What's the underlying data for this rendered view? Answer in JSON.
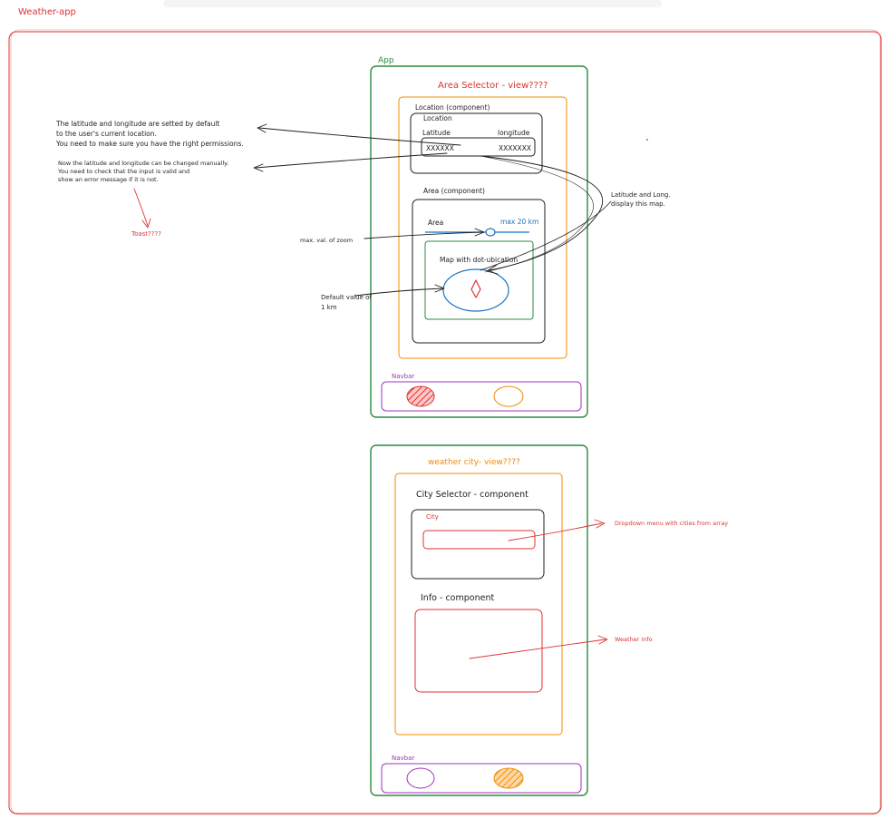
{
  "board": {
    "title": "Weather-app"
  },
  "app_label": "App",
  "colors": {
    "red": "#e03131",
    "green": "#2b8a3e",
    "orange": "#f08c00",
    "purple": "#9c36b5",
    "blue": "#1971c2",
    "ink": "#1e1e1e"
  },
  "area_view": {
    "title": "Area Selector - view????",
    "location_component_label": "Location (component)",
    "location_box_label": "Location",
    "latitude_label": "Latitude",
    "longitude_label": "longitude",
    "latitude_value": "XXXXXX",
    "longitude_value": "XXXXXXX",
    "area_component_label": "Area (component)",
    "area_label": "Area",
    "max_label": "max 20 km",
    "map_label": "Map with dot-ubication",
    "navbar_label": "Navbar"
  },
  "city_view": {
    "title": "weather city- view????",
    "city_selector_label": "City Selector - component",
    "city_field_label": "City",
    "info_label": "Info - component",
    "navbar_label": "Navbar"
  },
  "notes": {
    "default_location": [
      "The latitude and longitude are setted by default",
      "to the user's current location.",
      "You need to make sure you have the right permissions."
    ],
    "manual_change": [
      "Now the latitude and longitude can be changed manually.",
      "You need to check that the input is valid and",
      "show an error message if it is not."
    ],
    "toast": "Toast????",
    "lat_long_map": [
      "Latitude and Long.",
      "display this map."
    ],
    "max_zoom": "max. val. of zoom",
    "default_value": [
      "Default value of",
      "1 km"
    ],
    "dropdown": "Dropdown menu with cities from array",
    "weather_info": "Weather info"
  }
}
